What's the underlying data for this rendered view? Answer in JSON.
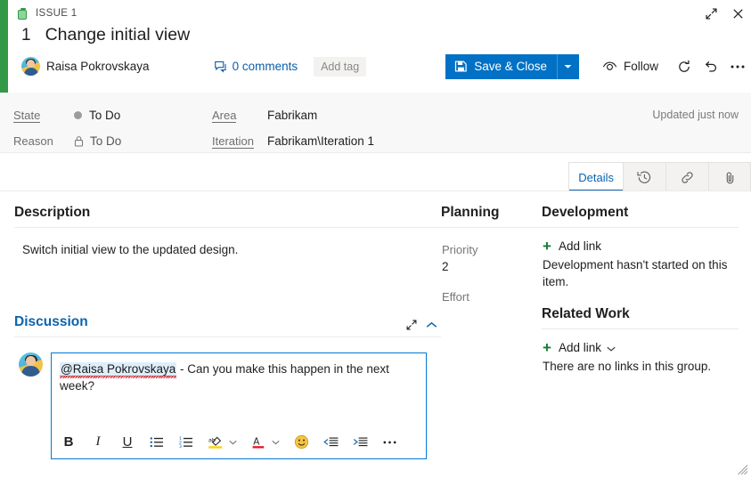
{
  "window": {
    "issue_label": "ISSUE 1",
    "expand_icon": "expand-diagonal-icon",
    "close_icon": "close-icon"
  },
  "header": {
    "work_item_id": "1",
    "title": "Change initial view",
    "assignee": "Raisa Pokrovskaya",
    "comments_label": "0 comments",
    "add_tag_label": "Add tag",
    "save_label": "Save & Close",
    "follow_label": "Follow",
    "refresh_icon": "refresh-icon",
    "undo_icon": "undo-icon",
    "more_icon": "ellipsis-icon",
    "accent_color": "#339947",
    "save_button_color": "#0071c5"
  },
  "fields": {
    "state": {
      "label": "State",
      "value": "To Do",
      "dot_color": "#9c9c9c"
    },
    "reason": {
      "label": "Reason",
      "value": "To Do",
      "icon": "lock-icon"
    },
    "area": {
      "label": "Area",
      "value": "Fabrikam"
    },
    "iteration": {
      "label": "Iteration",
      "value": "Fabrikam\\Iteration 1"
    },
    "updated_note": "Updated just now"
  },
  "tabs": [
    {
      "label": "Details",
      "icon": "",
      "active": true
    },
    {
      "label": "",
      "icon": "history-icon",
      "active": false
    },
    {
      "label": "",
      "icon": "link-icon",
      "active": false
    },
    {
      "label": "",
      "icon": "attachment-icon",
      "active": false
    }
  ],
  "description": {
    "title": "Description",
    "text": "Switch initial view to the updated design."
  },
  "discussion": {
    "title": "Discussion",
    "expand_icon": "expand-diagonal-icon",
    "collapse_icon": "chevron-up-icon",
    "comment": {
      "mention": "@Raisa Pokrovskaya",
      "text": " - Can you make this happen in the next week?"
    },
    "toolbar": {
      "bold": "B",
      "italic": "I",
      "underline": "U",
      "bulleted_list": "bulleted-list-icon",
      "numbered_list": "numbered-list-icon",
      "highlight": "highlight-icon",
      "font_color": "font-color-icon",
      "emoji": "emoji-icon",
      "outdent": "outdent-icon",
      "indent": "indent-icon",
      "more": "ellipsis-icon"
    }
  },
  "planning": {
    "title": "Planning",
    "priority_label": "Priority",
    "priority_value": "2",
    "effort_label": "Effort",
    "effort_value": ""
  },
  "development": {
    "title": "Development",
    "add_link_label": "Add link",
    "empty_text": "Development hasn't started on this item."
  },
  "related_work": {
    "title": "Related Work",
    "add_link_label": "Add link",
    "empty_text": "There are no links in this group."
  }
}
